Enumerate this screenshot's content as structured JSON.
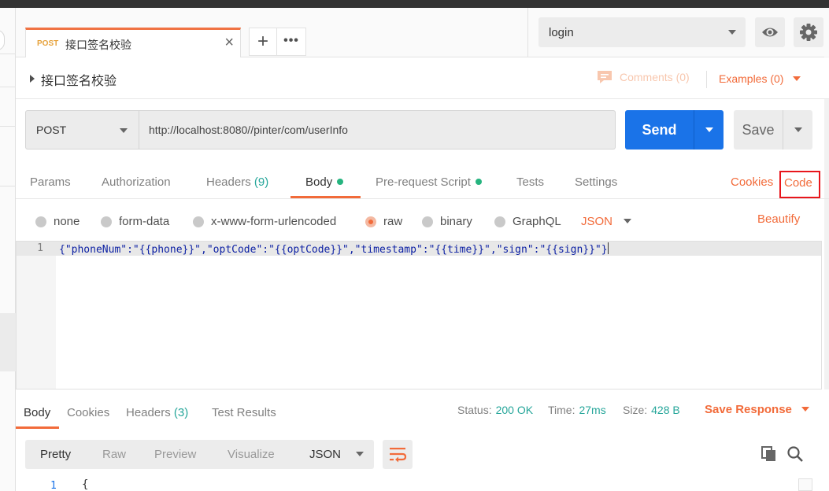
{
  "tab": {
    "method": "POST",
    "title": "接口签名校验"
  },
  "environment": {
    "selected": "login"
  },
  "request": {
    "name": "接口签名校验",
    "comments_label": "Comments (0)",
    "examples_label": "Examples (0)",
    "method": "POST",
    "url": "http://localhost:8080//pinter/com/userInfo",
    "send_label": "Send",
    "save_label": "Save"
  },
  "request_tabs": {
    "params": "Params",
    "authorization": "Authorization",
    "headers": "Headers",
    "headers_count": "(9)",
    "body": "Body",
    "prerequest": "Pre-request Script",
    "tests": "Tests",
    "settings": "Settings",
    "cookies": "Cookies",
    "code": "Code"
  },
  "body_types": {
    "none": "none",
    "form_data": "form-data",
    "urlencoded": "x-www-form-urlencoded",
    "raw": "raw",
    "binary": "binary",
    "graphql": "GraphQL",
    "format": "JSON",
    "beautify": "Beautify"
  },
  "editor": {
    "line_number": "1",
    "code": "{\"phoneNum\":\"{{phone}}\",\"optCode\":\"{{optCode}}\",\"timestamp\":\"{{time}}\",\"sign\":\"{{sign}}\"}"
  },
  "response": {
    "tabs": {
      "body": "Body",
      "cookies": "Cookies",
      "headers": "Headers",
      "headers_count": "(3)",
      "test_results": "Test Results"
    },
    "status_label": "Status:",
    "status_value": "200 OK",
    "time_label": "Time:",
    "time_value": "27ms",
    "size_label": "Size:",
    "size_value": "428 B",
    "save_response": "Save Response",
    "formats": {
      "pretty": "Pretty",
      "raw": "Raw",
      "preview": "Preview",
      "visualize": "Visualize"
    },
    "type": "JSON",
    "line_number": "1",
    "first_line": "{"
  },
  "colors": {
    "accent": "#f26b3a",
    "send": "#1a73e8",
    "success": "#26a69a",
    "highlight_box": "#e8161c"
  }
}
